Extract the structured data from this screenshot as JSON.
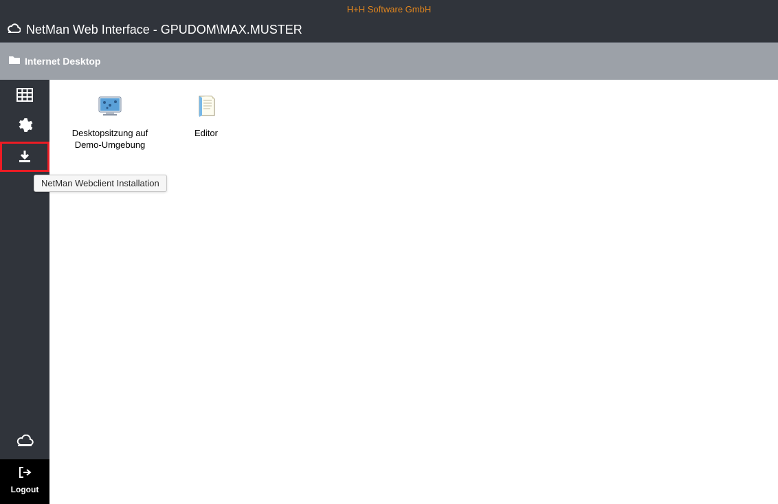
{
  "header": {
    "brand": "H+H Software GmbH",
    "title": "NetMan Web Interface - GPUDOM\\MAX.MUSTER"
  },
  "breadcrumb": {
    "path": "Internet Desktop"
  },
  "sidebar": {
    "items": [
      {
        "name": "apps-grid"
      },
      {
        "name": "settings"
      },
      {
        "name": "download"
      }
    ],
    "tooltip": "NetMan Webclient Installation",
    "logout_label": "Logout"
  },
  "content": {
    "apps": [
      {
        "label": "Desktopsitzung auf Demo-Umgebung",
        "icon": "desktop-session"
      },
      {
        "label": "Editor",
        "icon": "editor"
      }
    ]
  }
}
